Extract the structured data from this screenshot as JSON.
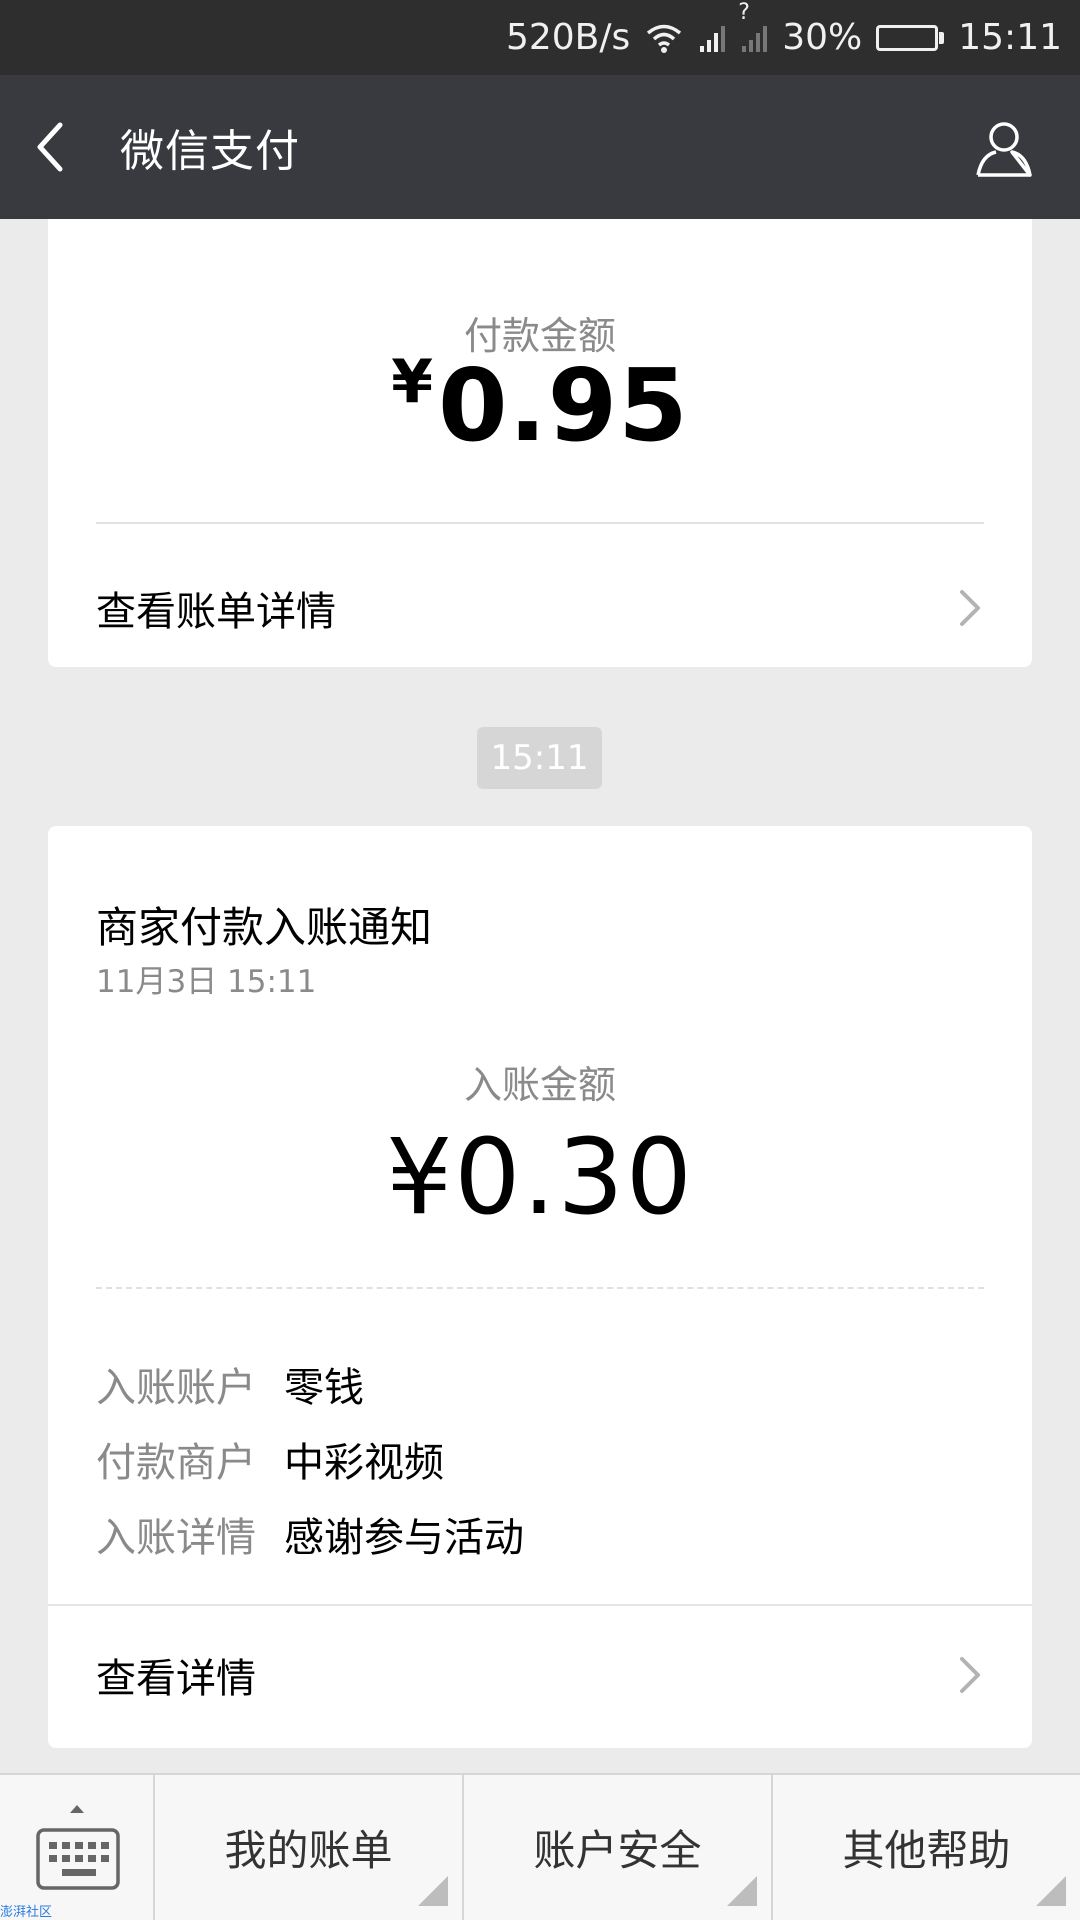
{
  "status_bar": {
    "net_speed": "520B/s",
    "sim_unknown": "?",
    "battery": "30%",
    "time": "15:11"
  },
  "header": {
    "title": "微信支付"
  },
  "payment_card": {
    "label": "付款金额",
    "currency": "¥",
    "amount": "0.95",
    "view_bill": "查看账单详情"
  },
  "timestamp_chip": "15:11",
  "notice_card": {
    "title": "商家付款入账通知",
    "date": "11月3日  15:11",
    "amount_label": "入账金额",
    "amount": "¥0.30",
    "details": [
      {
        "key": "入账账户",
        "value": "零钱"
      },
      {
        "key": "付款商户",
        "value": "中彩视频"
      },
      {
        "key": "入账详情",
        "value": "感谢参与活动"
      }
    ],
    "view_details": "查看详情"
  },
  "bottom_menu": {
    "items": [
      "我的账单",
      "账户安全",
      "其他帮助"
    ]
  },
  "watermark": "澎湃社区",
  "colors": {
    "status_bar_bg": "#2e2e2e",
    "title_bar_bg": "#393a3f",
    "page_bg": "#ebebeb",
    "battery": "#4cd964"
  }
}
